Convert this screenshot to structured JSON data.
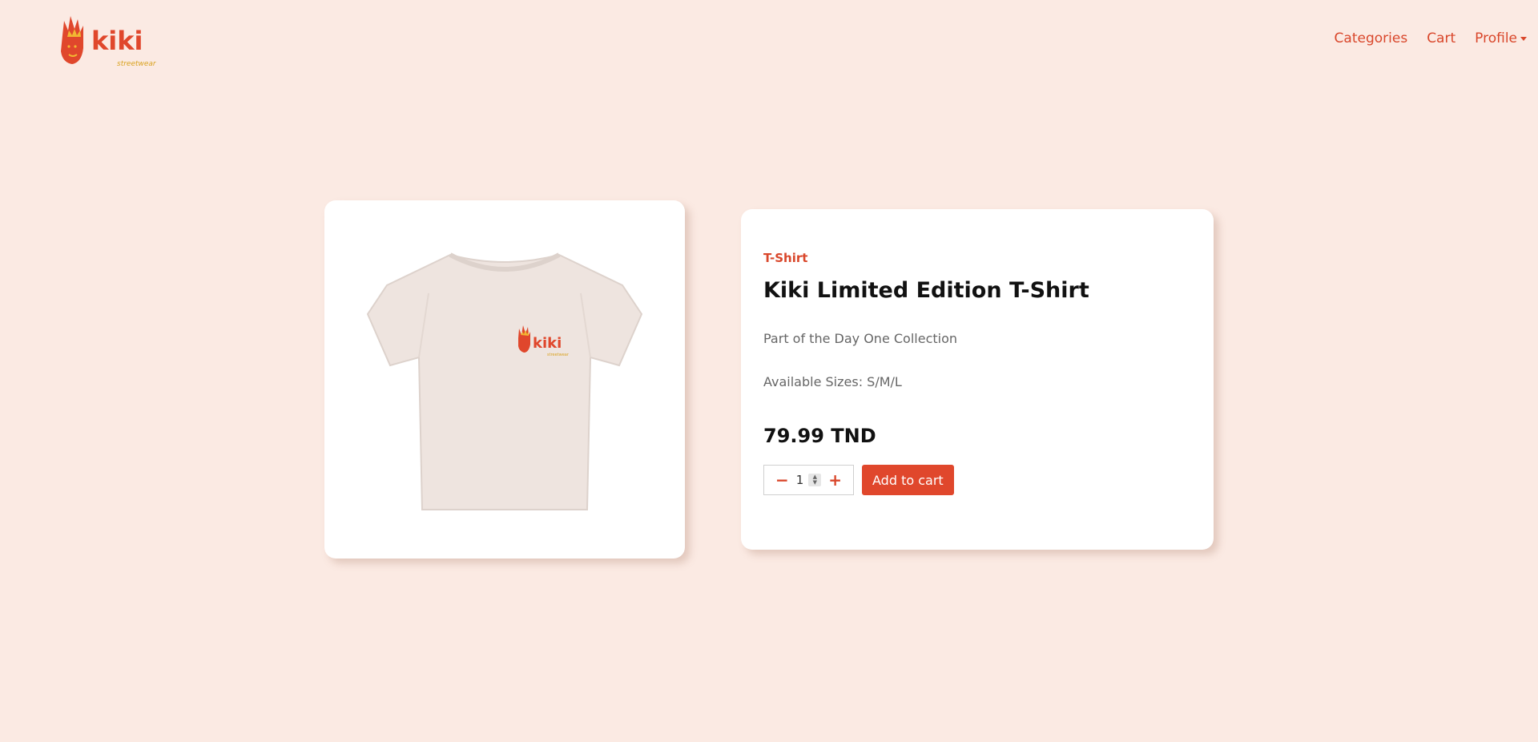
{
  "brand": {
    "logo_text": "kiki",
    "logo_subtext": "streetwear"
  },
  "nav": {
    "items": [
      {
        "label": "Categories"
      },
      {
        "label": "Cart"
      },
      {
        "label": "Profile"
      }
    ]
  },
  "product": {
    "image_alt": "Kiki Limited Edition T-Shirt",
    "category": "T-Shirt",
    "title": "Kiki Limited Edition T-Shirt",
    "description": "Part of the Day One Collection",
    "sizes": "Available Sizes: S/M/L",
    "price": "79.99 TND",
    "quantity": "1",
    "minus_label": "−",
    "plus_label": "+",
    "add_to_cart_label": "Add to cart"
  },
  "colors": {
    "background": "#fbeae3",
    "accent": "#e0472c",
    "logo_yellow": "#f2b632",
    "shirt": "#eee4df"
  },
  "icons": {
    "logo": "kiki-hand-crown-logo",
    "profile_dropdown": "caret-down-icon",
    "stepper": "spinner-arrows-icon"
  }
}
